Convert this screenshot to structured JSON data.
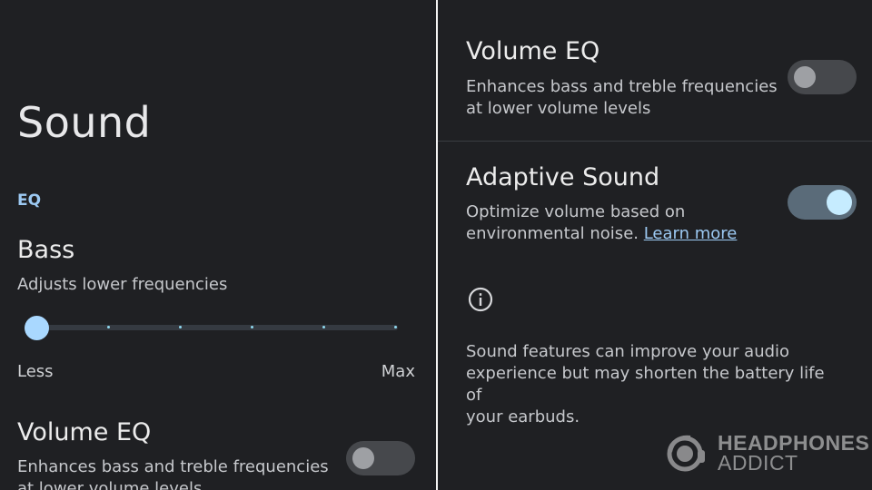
{
  "left": {
    "title": "Sound",
    "section": "EQ",
    "bass": {
      "title": "Bass",
      "subtitle": "Adjusts lower frequencies",
      "min_label": "Less",
      "max_label": "Max",
      "level": 0
    },
    "volume_eq": {
      "title": "Volume EQ",
      "subtitle_line1": "Enhances bass and treble frequencies",
      "subtitle_line2": "at lower volume levels",
      "enabled": false
    }
  },
  "right": {
    "volume_eq": {
      "title": "Volume EQ",
      "subtitle_line1": "Enhances bass and treble frequencies",
      "subtitle_line2": "at lower volume levels",
      "enabled": false
    },
    "adaptive_sound": {
      "title": "Adaptive Sound",
      "subtitle_line1": "Optimize volume based on",
      "subtitle_line2": "environmental noise.",
      "link": "Learn more",
      "enabled": true
    },
    "info": {
      "icon": "info-icon",
      "text_line1": "Sound features can improve your audio",
      "text_line2": "experience but may shorten the battery life of",
      "text_line3": "your earbuds."
    }
  },
  "watermark": {
    "line1": "HEADPHONES",
    "line2": "ADDICT"
  },
  "colors": {
    "background": "#1f2023",
    "accent": "#9cc9f2",
    "toggle_on_track": "#5a6b79",
    "toggle_on_knob": "#c6ecff",
    "toggle_off_track": "#46484c"
  }
}
